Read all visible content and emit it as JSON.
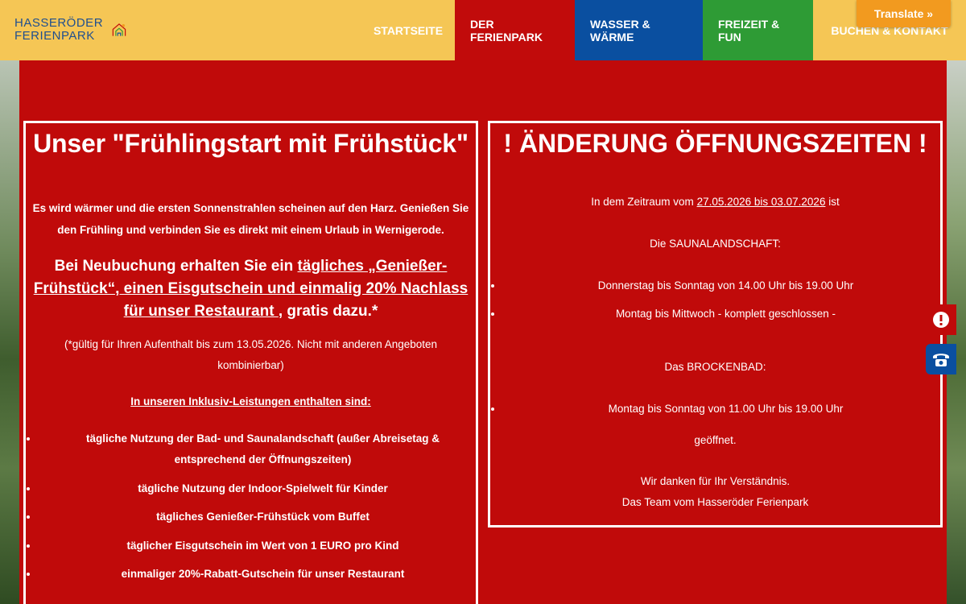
{
  "brand": {
    "name_line1": "HASSERÖDER",
    "name_line2": "FERIENPARK",
    "logo_icon": "house-logo-icon"
  },
  "nav": {
    "items": [
      {
        "label": "STARTSEITE",
        "color": "#f5c655"
      },
      {
        "label": "DER FERIENPARK",
        "color": "#c10b0b"
      },
      {
        "label": "WASSER & WÄRME",
        "color": "#0a4fa0"
      },
      {
        "label": "FREIZEIT & FUN",
        "color": "#2e9b35"
      },
      {
        "label": "BUCHEN & KONTAKT",
        "color": "#f5c655"
      }
    ]
  },
  "translate": {
    "label": "Translate »"
  },
  "left_box": {
    "title": "Unser \"Frühlingstart mit Frühstück\"",
    "intro": "Es wird wärmer und die ersten Sonnenstrahlen scheinen auf den Harz. Genießen Sie den Frühling und verbinden Sie es direkt mit einem Urlaub in Wernigerode.",
    "offer_prefix": "Bei Neubuchung erhalten Sie ein ",
    "offer_link": "tägliches „Genießer-Frühstück“, einen Eisgutschein und einmalig 20% Nachlass für unser Restaurant ",
    "offer_suffix": ", gratis dazu.*",
    "note": "(*gültig für Ihren Aufenthalt bis zum 13.05.2026. Nicht mit anderen Angeboten kombinierbar)",
    "inclusive_title": "In unseren Inklusiv-Leistungen enthalten sind:",
    "inclusive_items": [
      "tägliche Nutzung der Bad- und Saunalandschaft (außer Abreisetag & entsprechend der Öffnungszeiten)",
      "tägliche Nutzung der Indoor-Spielwelt für Kinder",
      "tägliches Genießer-Frühstück vom Buffet",
      "täglicher Eisgutschein im Wert von 1 EURO pro Kind",
      "einmaliger 20%-Rabatt-Gutschein für unser Restaurant"
    ]
  },
  "right_box": {
    "title": "! ÄNDERUNG ÖFFNUNGSZEITEN !",
    "period_prefix": "In dem Zeitraum vom ",
    "period_dates": "27.05.2026 bis 03.07.2026",
    "period_suffix": " ist",
    "sauna_heading": "Die SAUNALANDSCHAFT:",
    "sauna_items": [
      "Donnerstag bis Sonntag von 14.00 Uhr bis 19.00 Uhr",
      "Montag bis Mittwoch - komplett geschlossen -"
    ],
    "bad_heading": "Das BROCKENBAD:",
    "bad_items": [
      "Montag bis Sonntag von 11.00 Uhr bis 19.00 Uhr"
    ],
    "opened": "geöffnet.",
    "thanks": "Wir danken für Ihr Verständnis.",
    "team": "Das Team vom Hasseröder Ferienpark"
  },
  "side_buttons": {
    "alert_icon": "alert-icon",
    "phone_icon": "phone-icon"
  }
}
